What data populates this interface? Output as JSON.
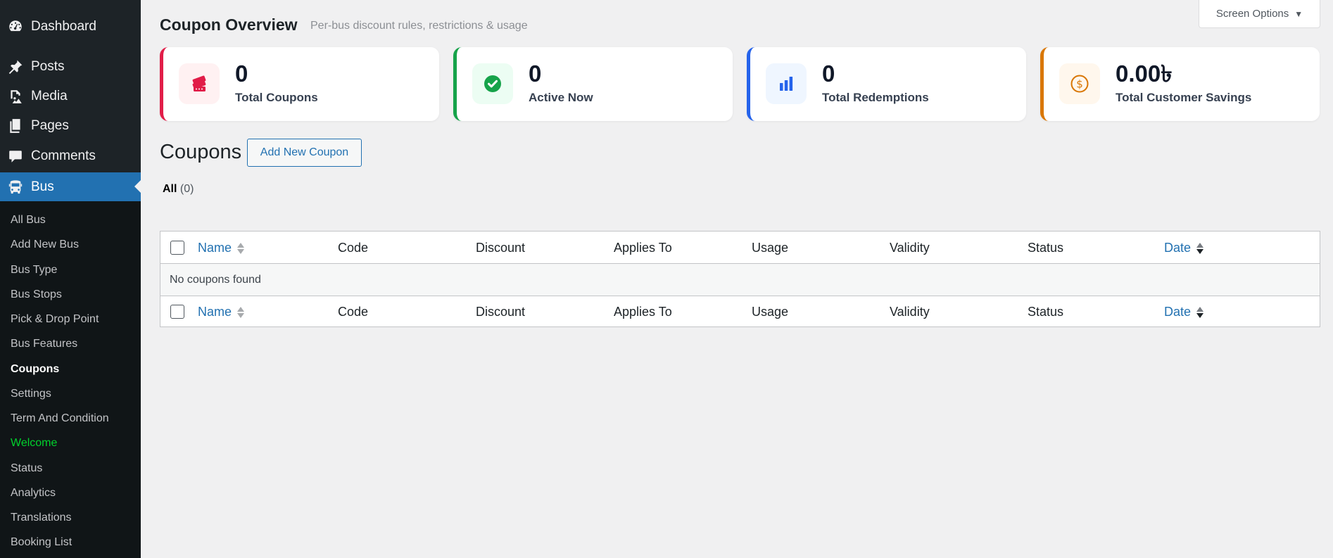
{
  "sidebar": {
    "top_items": [
      {
        "label": "Dashboard",
        "icon": "dashboard-icon"
      },
      {
        "label": "Posts",
        "icon": "pin-icon"
      },
      {
        "label": "Media",
        "icon": "media-icon"
      },
      {
        "label": "Pages",
        "icon": "pages-icon"
      },
      {
        "label": "Comments",
        "icon": "comment-icon"
      },
      {
        "label": "Bus",
        "icon": "bus-icon",
        "current": true
      }
    ],
    "sub_items": [
      {
        "label": "All Bus"
      },
      {
        "label": "Add New Bus"
      },
      {
        "label": "Bus Type"
      },
      {
        "label": "Bus Stops"
      },
      {
        "label": "Pick & Drop Point"
      },
      {
        "label": "Bus Features"
      },
      {
        "label": "Coupons",
        "current": true
      },
      {
        "label": "Settings"
      },
      {
        "label": "Term And Condition"
      },
      {
        "label": "Welcome",
        "color": "#00d22c"
      },
      {
        "label": "Status"
      },
      {
        "label": "Analytics"
      },
      {
        "label": "Translations"
      },
      {
        "label": "Booking List"
      }
    ]
  },
  "screen_options": {
    "label": "Screen Options",
    "arrow": "▼"
  },
  "header": {
    "title": "Coupon Overview",
    "subtitle": "Per-bus discount rules, restrictions & usage"
  },
  "stats": [
    {
      "value": "0",
      "label": "Total Coupons",
      "icon": "ticket-icon",
      "accent": "#e11d48",
      "icon_bg": "#fff1f2"
    },
    {
      "value": "0",
      "label": "Active Now",
      "icon": "check-circle-icon",
      "accent": "#16a34a",
      "icon_bg": "#ecfdf3"
    },
    {
      "value": "0",
      "label": "Total Redemptions",
      "icon": "bar-chart-icon",
      "accent": "#2563eb",
      "icon_bg": "#eff6ff"
    },
    {
      "value": "0.00৳",
      "label": "Total Customer Savings",
      "icon": "dollar-coin-icon",
      "accent": "#d97706",
      "icon_bg": "#fff7ed"
    }
  ],
  "list": {
    "title": "Coupons",
    "add_new_label": "Add New Coupon",
    "filter_all_label": "All",
    "filter_all_count": "(0)"
  },
  "table": {
    "columns": [
      {
        "label": "Name",
        "sortable": true
      },
      {
        "label": "Code"
      },
      {
        "label": "Discount"
      },
      {
        "label": "Applies To"
      },
      {
        "label": "Usage"
      },
      {
        "label": "Validity"
      },
      {
        "label": "Status"
      },
      {
        "label": "Date",
        "sortable": true,
        "sorted": "desc"
      }
    ],
    "empty_message": "No coupons found"
  },
  "colors": {
    "sidebar_bg": "#1d2327",
    "submenu_bg": "#101517",
    "active_menu": "#2271b1",
    "link": "#2271b1"
  }
}
